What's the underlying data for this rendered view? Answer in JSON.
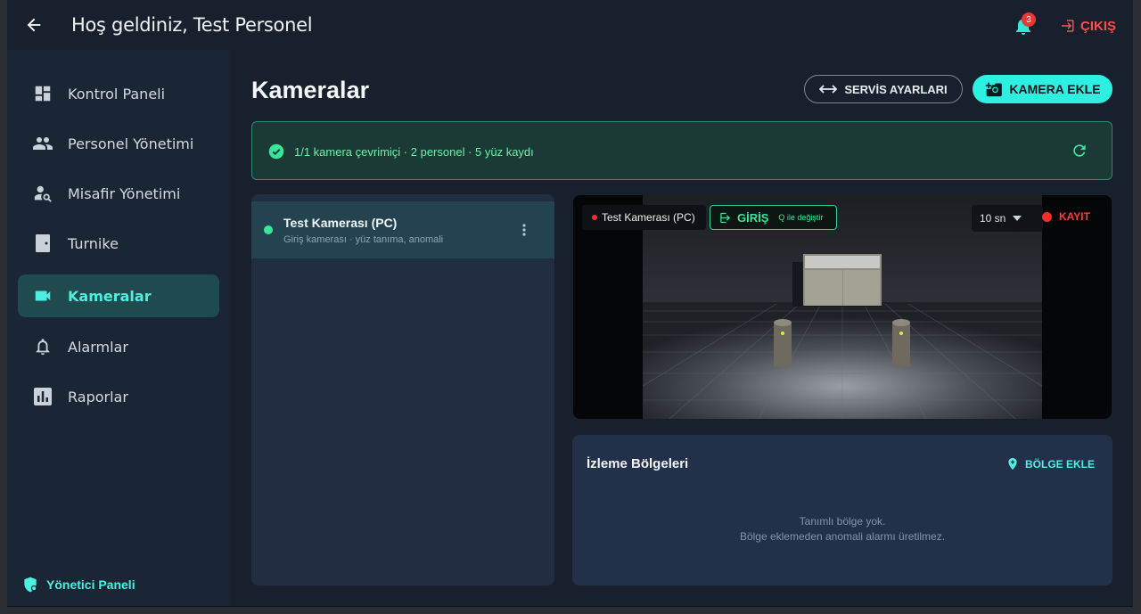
{
  "topbar": {
    "title": "Hoş geldiniz, Test Personel",
    "notification_count": "3",
    "logout_label": "ÇIKIŞ"
  },
  "sidebar": {
    "items": [
      {
        "label": "Kontrol Paneli",
        "icon": "dashboard-icon"
      },
      {
        "label": "Personel Yönetimi",
        "icon": "people-icon"
      },
      {
        "label": "Misafir Yönetimi",
        "icon": "person-search-icon"
      },
      {
        "label": "Turnike",
        "icon": "door-icon"
      },
      {
        "label": "Kameralar",
        "icon": "videocam-icon",
        "active": true
      },
      {
        "label": "Alarmlar",
        "icon": "bell-icon"
      },
      {
        "label": "Raporlar",
        "icon": "bar-chart-icon"
      }
    ],
    "admin_label": "Yönetici Paneli"
  },
  "main": {
    "title": "Kameralar",
    "service_settings_label": "SERVİS AYARLARI",
    "add_camera_label": "KAMERA EKLE",
    "status_text": "1/1 kamera çevrimiçi · 2 personel · 5 yüz kaydı",
    "cameras": [
      {
        "name": "Test Kamerası (PC)",
        "subtitle": "Giriş kamerası · yüz tanıma, anomali",
        "online": true
      }
    ],
    "video": {
      "camera_label": "Test Kamerası (PC)",
      "mode_label": "GİRİŞ",
      "mode_hint": "Q ile değiştir",
      "interval_value": "10 sn",
      "record_label": "KAYIT"
    },
    "zones": {
      "title": "İzleme Bölgeleri",
      "add_label": "BÖLGE EKLE",
      "empty_line1": "Tanımlı bölge yok.",
      "empty_line2": "Bölge eklemeden anomali alarmı üretilmez."
    }
  },
  "colors": {
    "accent": "#2ef0e0",
    "success": "#3ae69a",
    "danger": "#ff4d4d"
  }
}
